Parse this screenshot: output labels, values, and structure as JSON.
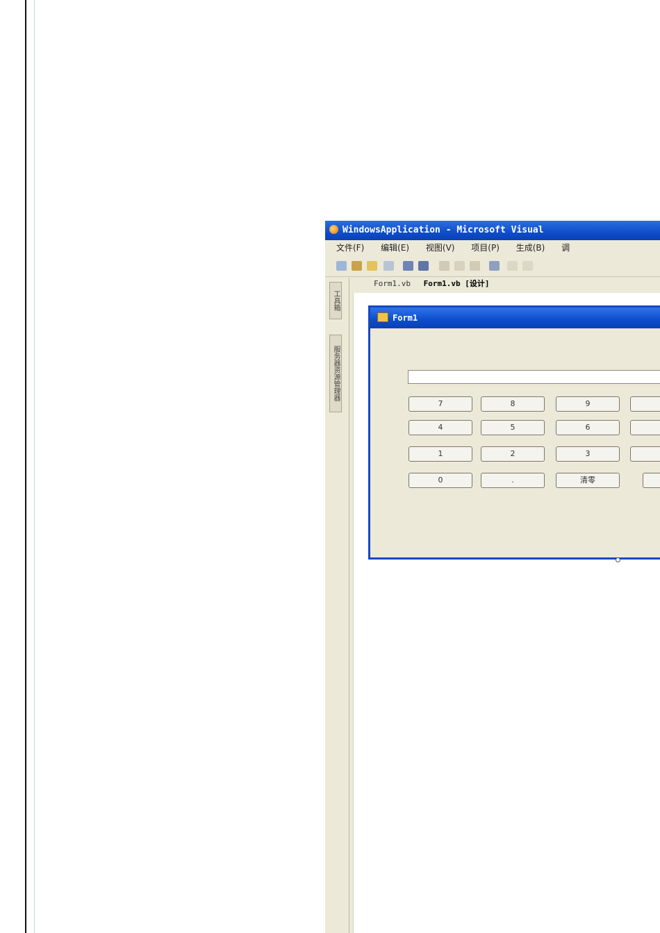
{
  "ide": {
    "title": "WindowsApplication - Microsoft Visual",
    "menu": [
      "文件(F)",
      "编辑(E)",
      "视图(V)",
      "项目(P)",
      "生成(B)",
      "调"
    ],
    "tabs": [
      "Form1.vb",
      "Form1.vb [设计]"
    ],
    "sidebar_tabs": [
      "工具箱",
      "服务器资源管理器"
    ]
  },
  "form": {
    "title": "Form1",
    "display_value": "",
    "keys": [
      "7",
      "8",
      "9",
      "",
      "4",
      "5",
      "6",
      "",
      "1",
      "2",
      "3",
      "",
      "0",
      ".",
      "清零",
      ""
    ]
  },
  "colors": {
    "titlebar": "#0f4dc9",
    "window_bg": "#ece9d8",
    "form_border": "#1748c0"
  }
}
